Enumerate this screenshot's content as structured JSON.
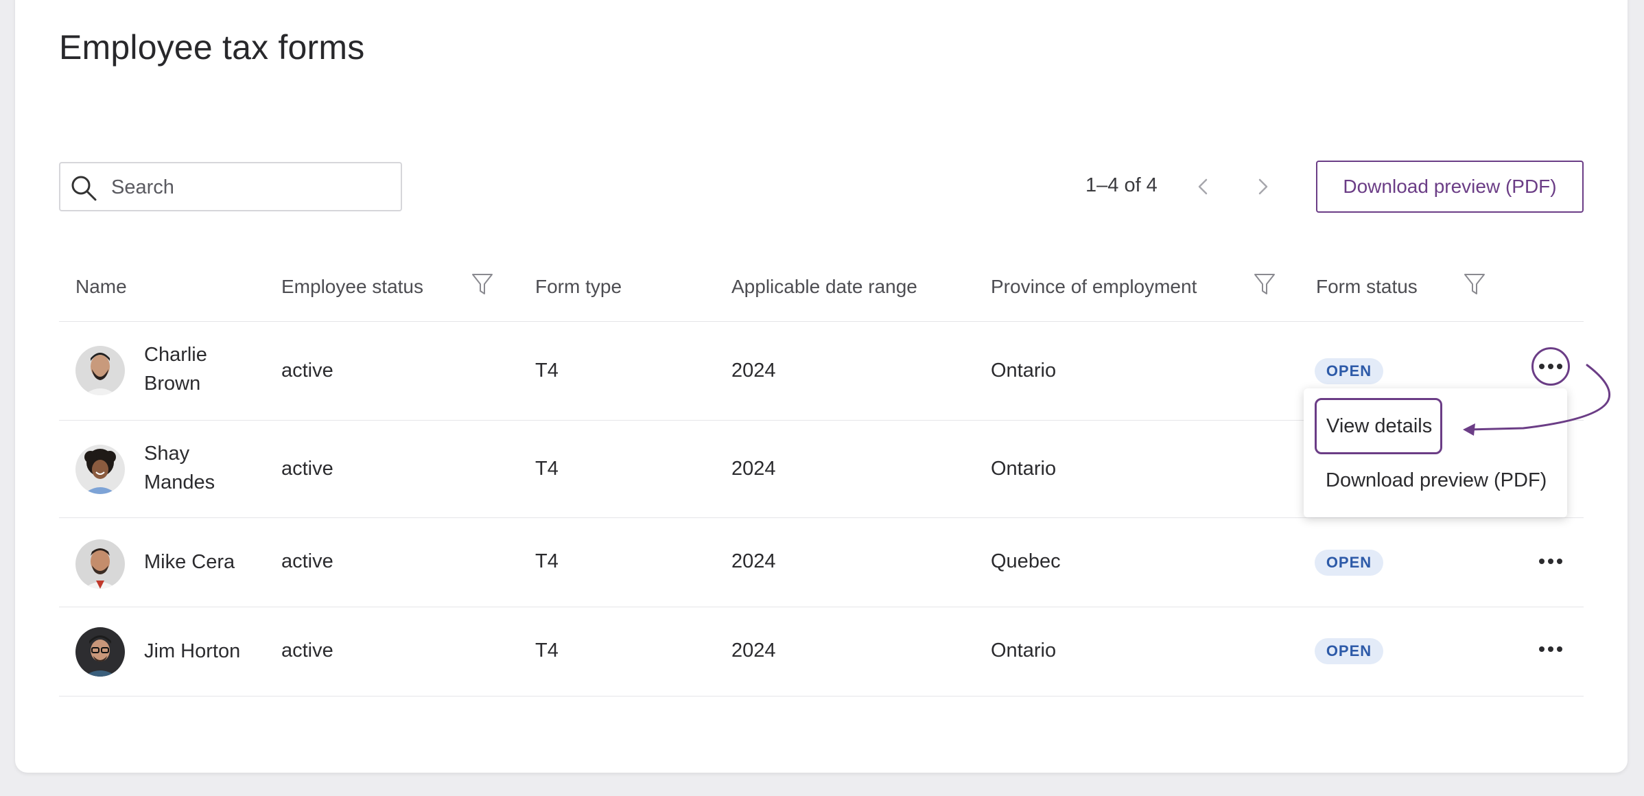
{
  "page": {
    "title": "Employee tax forms"
  },
  "search": {
    "placeholder": "Search"
  },
  "pagination": {
    "text": "1–4 of 4"
  },
  "toolbar": {
    "download_label": "Download preview (PDF)"
  },
  "table": {
    "columns": [
      "Name",
      "Employee status",
      "Form type",
      "Applicable date range",
      "Province of employment",
      "Form status"
    ],
    "rows": [
      {
        "name_line1": "Charlie",
        "name_line2": "Brown",
        "status": "active",
        "form_type": "T4",
        "date_range": "2024",
        "province": "Ontario",
        "form_status": "OPEN"
      },
      {
        "name_line1": "Shay",
        "name_line2": "Mandes",
        "status": "active",
        "form_type": "T4",
        "date_range": "2024",
        "province": "Ontario",
        "form_status": ""
      },
      {
        "name": "Mike Cera",
        "status": "active",
        "form_type": "T4",
        "date_range": "2024",
        "province": "Quebec",
        "form_status": "OPEN"
      },
      {
        "name": "Jim Horton",
        "status": "active",
        "form_type": "T4",
        "date_range": "2024",
        "province": "Ontario",
        "form_status": "OPEN"
      }
    ]
  },
  "row_menu": {
    "items": [
      "View details",
      "Download preview (PDF)"
    ]
  },
  "colors": {
    "accent": "#6b3d86",
    "badge_bg": "#e3ebf8",
    "badge_text": "#2d5aa8"
  },
  "icons": [
    "search-icon",
    "chevron-left-icon",
    "chevron-right-icon",
    "filter-icon",
    "more-icon",
    "annotation-arrow"
  ]
}
